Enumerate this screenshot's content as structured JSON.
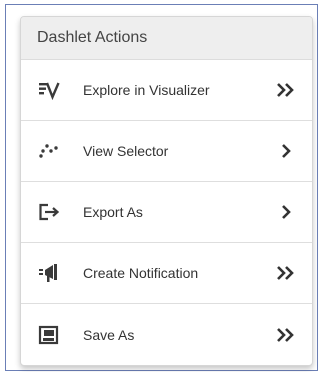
{
  "panel": {
    "title": "Dashlet Actions",
    "items": [
      {
        "label": "Explore in Visualizer",
        "icon": "visualizer-icon",
        "indicator": "double-chevron"
      },
      {
        "label": "View Selector",
        "icon": "view-selector-icon",
        "indicator": "chevron"
      },
      {
        "label": "Export As",
        "icon": "export-icon",
        "indicator": "chevron"
      },
      {
        "label": "Create Notification",
        "icon": "notification-megaphone-icon",
        "indicator": "double-chevron"
      },
      {
        "label": "Save As",
        "icon": "save-icon",
        "indicator": "double-chevron"
      }
    ]
  },
  "colors": {
    "frame_border": "#6b7fb6",
    "header_bg": "#eeeeee",
    "text": "#333333",
    "icon": "#3a3a3a"
  }
}
